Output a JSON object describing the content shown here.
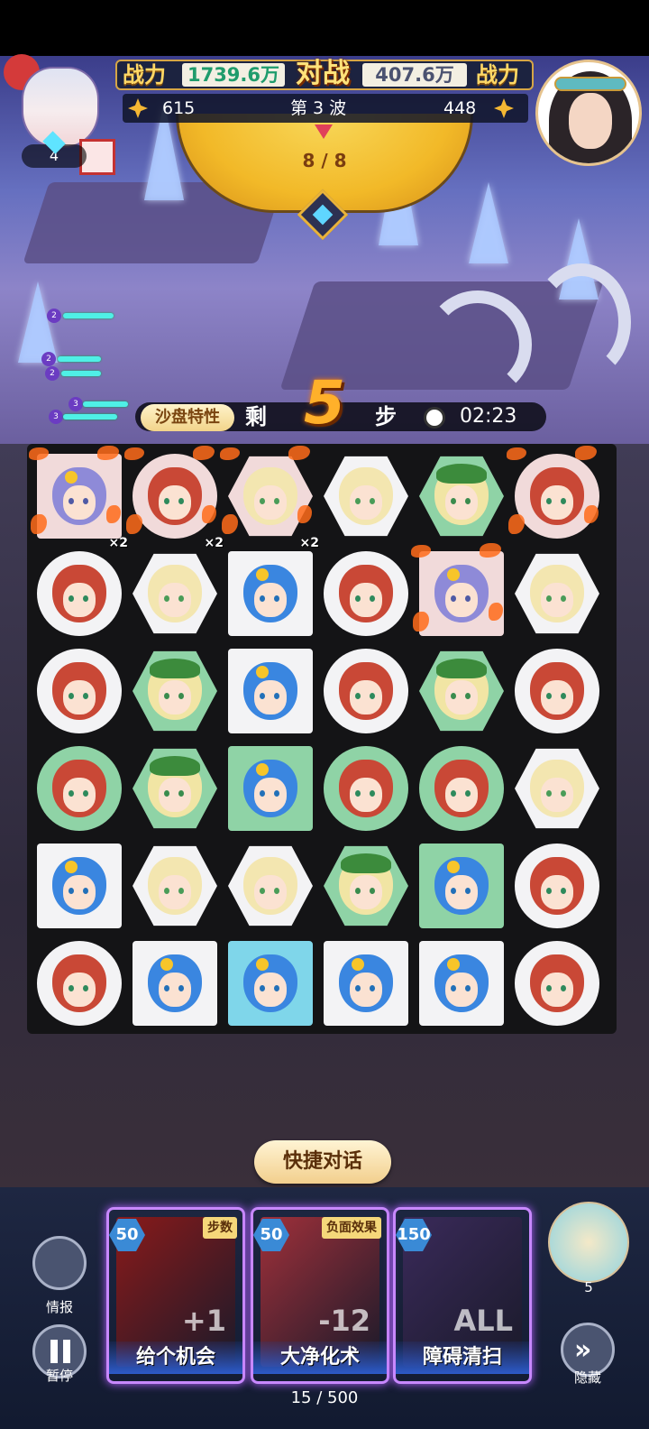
{
  "header": {
    "left_power_label": "战力",
    "left_power_value": "1739.6万",
    "vs_label": "对战",
    "right_power_value": "407.6万",
    "right_power_label": "战力",
    "left_score": "615",
    "wave_text": "第 3 波",
    "right_score": "448",
    "wave_progress": "8 / 8",
    "gem_count": "4"
  },
  "turns": {
    "trait_label": "沙盘特性",
    "remain_label": "剩",
    "steps_left": "5",
    "step_label": "步",
    "timer": "02:23"
  },
  "board": {
    "rows": [
      [
        {
          "hero": "purple",
          "shape": "square",
          "bg": "pink",
          "mult": "×2",
          "fire": true
        },
        {
          "hero": "red",
          "shape": "circle",
          "bg": "pink",
          "mult": "×2",
          "fire": true
        },
        {
          "hero": "yellow",
          "shape": "hex",
          "bg": "pink",
          "mult": "×2",
          "fire": true
        },
        {
          "hero": "yellow",
          "shape": "hex",
          "bg": "white",
          "mult": "",
          "fire": false
        },
        {
          "hero": "greenleaf",
          "shape": "hex",
          "bg": "green",
          "mult": "",
          "fire": false
        },
        {
          "hero": "red",
          "shape": "circle",
          "bg": "pink",
          "mult": "",
          "fire": true
        }
      ],
      [
        {
          "hero": "red",
          "shape": "circle",
          "bg": "white",
          "mult": "",
          "fire": false
        },
        {
          "hero": "yellow",
          "shape": "hex",
          "bg": "white",
          "mult": "",
          "fire": false
        },
        {
          "hero": "blue",
          "shape": "square",
          "bg": "white",
          "mult": "",
          "fire": false
        },
        {
          "hero": "red",
          "shape": "circle",
          "bg": "white",
          "mult": "",
          "fire": false
        },
        {
          "hero": "purple",
          "shape": "square",
          "bg": "pink",
          "mult": "",
          "fire": true
        },
        {
          "hero": "yellow",
          "shape": "hex",
          "bg": "white",
          "mult": "",
          "fire": false
        }
      ],
      [
        {
          "hero": "red",
          "shape": "circle",
          "bg": "white",
          "mult": "",
          "fire": false
        },
        {
          "hero": "greenleaf",
          "shape": "hex",
          "bg": "green",
          "mult": "",
          "fire": false
        },
        {
          "hero": "blue",
          "shape": "square",
          "bg": "white",
          "mult": "",
          "fire": false
        },
        {
          "hero": "red",
          "shape": "circle",
          "bg": "white",
          "mult": "",
          "fire": false
        },
        {
          "hero": "greenleaf",
          "shape": "hex",
          "bg": "green",
          "mult": "",
          "fire": false
        },
        {
          "hero": "red",
          "shape": "circle",
          "bg": "white",
          "mult": "",
          "fire": false
        }
      ],
      [
        {
          "hero": "red",
          "shape": "circle",
          "bg": "green",
          "mult": "",
          "fire": false
        },
        {
          "hero": "greenleaf",
          "shape": "hex",
          "bg": "green",
          "mult": "",
          "fire": false
        },
        {
          "hero": "blue",
          "shape": "square",
          "bg": "green",
          "mult": "",
          "fire": false
        },
        {
          "hero": "red",
          "shape": "circle",
          "bg": "green",
          "mult": "",
          "fire": false
        },
        {
          "hero": "red",
          "shape": "circle",
          "bg": "green",
          "mult": "",
          "fire": false
        },
        {
          "hero": "yellow",
          "shape": "hex",
          "bg": "white",
          "mult": "",
          "fire": false
        }
      ],
      [
        {
          "hero": "blue",
          "shape": "square",
          "bg": "white",
          "mult": "",
          "fire": false
        },
        {
          "hero": "yellow",
          "shape": "hex",
          "bg": "white",
          "mult": "",
          "fire": false
        },
        {
          "hero": "yellow",
          "shape": "hex",
          "bg": "white",
          "mult": "",
          "fire": false
        },
        {
          "hero": "greenleaf",
          "shape": "hex",
          "bg": "green",
          "mult": "",
          "fire": false
        },
        {
          "hero": "blue",
          "shape": "square",
          "bg": "green",
          "mult": "",
          "fire": false
        },
        {
          "hero": "red",
          "shape": "circle",
          "bg": "white",
          "mult": "",
          "fire": false
        }
      ],
      [
        {
          "hero": "red",
          "shape": "circle",
          "bg": "white",
          "mult": "",
          "fire": false
        },
        {
          "hero": "blue",
          "shape": "square",
          "bg": "white",
          "mult": "",
          "fire": false
        },
        {
          "hero": "blue",
          "shape": "square",
          "bg": "cyan",
          "mult": "",
          "fire": false
        },
        {
          "hero": "blue",
          "shape": "square",
          "bg": "white",
          "mult": "",
          "fire": false
        },
        {
          "hero": "blue",
          "shape": "square",
          "bg": "white",
          "mult": "",
          "fire": false
        },
        {
          "hero": "red",
          "shape": "circle",
          "bg": "white",
          "mult": "",
          "fire": false
        }
      ]
    ]
  },
  "chat": {
    "label": "快捷对话"
  },
  "cards": [
    {
      "cost": "50",
      "tag": "步数",
      "big": "+1",
      "name": "给个机会",
      "color": "#8a1a1a"
    },
    {
      "cost": "50",
      "tag": "负面效果",
      "big": "-12",
      "name": "大净化术",
      "color": "#a0303a"
    },
    {
      "cost": "150",
      "tag": "",
      "big": "ALL",
      "name": "障碍清扫",
      "color": "#3a2a5a"
    }
  ],
  "footer": {
    "intel_label": "情报",
    "pause_label": "暂停",
    "hide_label": "隐藏",
    "progress": "15 / 500",
    "hero_count": "5"
  },
  "colors": {
    "accent": "#ffb02a",
    "card_glow": "#b260ff"
  }
}
